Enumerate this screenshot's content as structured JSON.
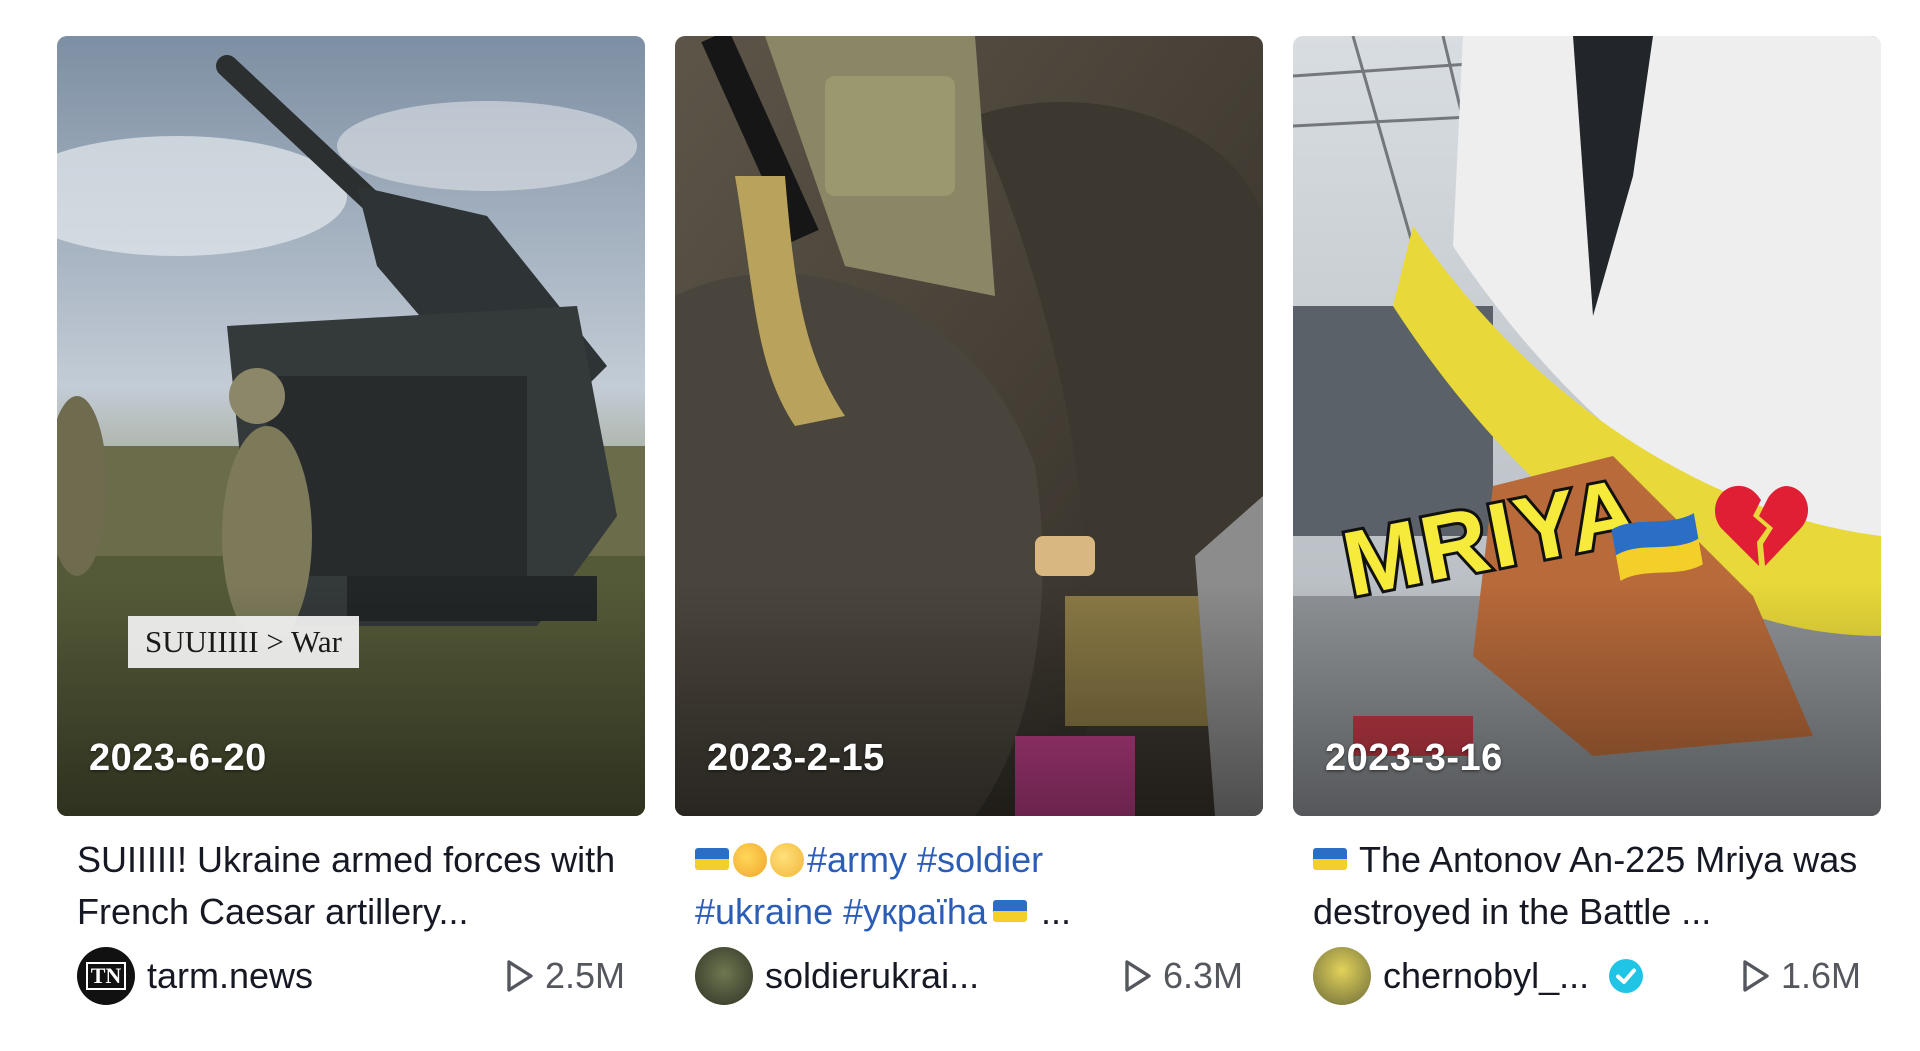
{
  "cards": [
    {
      "date": "2023-6-20",
      "overlay_text": "SUUIIIII > War",
      "caption": "SUIIIII! Ukraine armed forces with French Caesar artillery...",
      "username": "tarm.news",
      "avatar_text": "TN",
      "play_count": "2.5M"
    },
    {
      "date": "2023-2-15",
      "caption_parts": {
        "hashtags_line1": "#army #soldier",
        "hashtags_line2": "#ukraine #укpaïha",
        "ellipsis": " ..."
      },
      "username": "soldierukrai...",
      "play_count": "6.3M"
    },
    {
      "date": "2023-3-16",
      "overlay_text": "MRIYA",
      "caption": "The Antonov An-225 Mriya was destroyed in the Battle ...",
      "username": "chernobyl_...",
      "verified": true,
      "play_count": "1.6M"
    }
  ],
  "colors": {
    "hashtag": "#2b5db7",
    "verified": "#20c5e6",
    "flag_blue": "#2a6ec6",
    "flag_yellow": "#f3cf2a"
  },
  "icons": [
    "play-icon",
    "verified-icon",
    "ukraine-flag-emoji",
    "broken-heart-emoji",
    "smiling-hearts-emoji",
    "pleading-face-emoji"
  ]
}
